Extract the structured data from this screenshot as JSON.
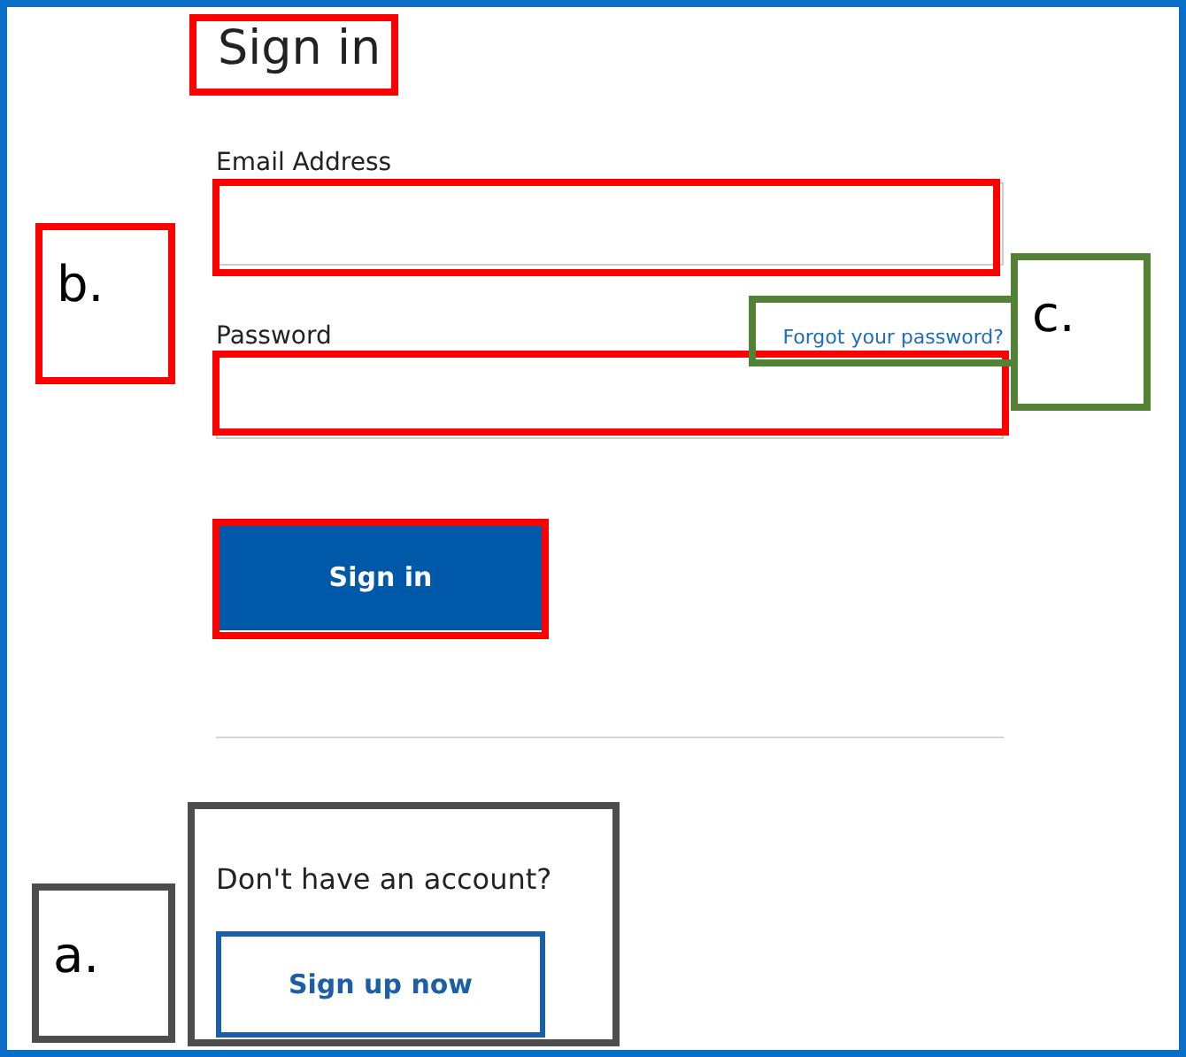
{
  "title": "Sign in",
  "fields": [
    {
      "label": "Email Address"
    },
    {
      "label": "Password",
      "link": "Forgot your password?"
    }
  ],
  "submit": "Sign in",
  "signup": {
    "prompt": "Don't have an account?",
    "button": "Sign up now"
  },
  "annotations": [
    {
      "label": "b.",
      "color": "#ff0000"
    },
    {
      "label": "c.",
      "color": "#538135"
    },
    {
      "label": "a.",
      "color": "#4d4d4d"
    }
  ]
}
